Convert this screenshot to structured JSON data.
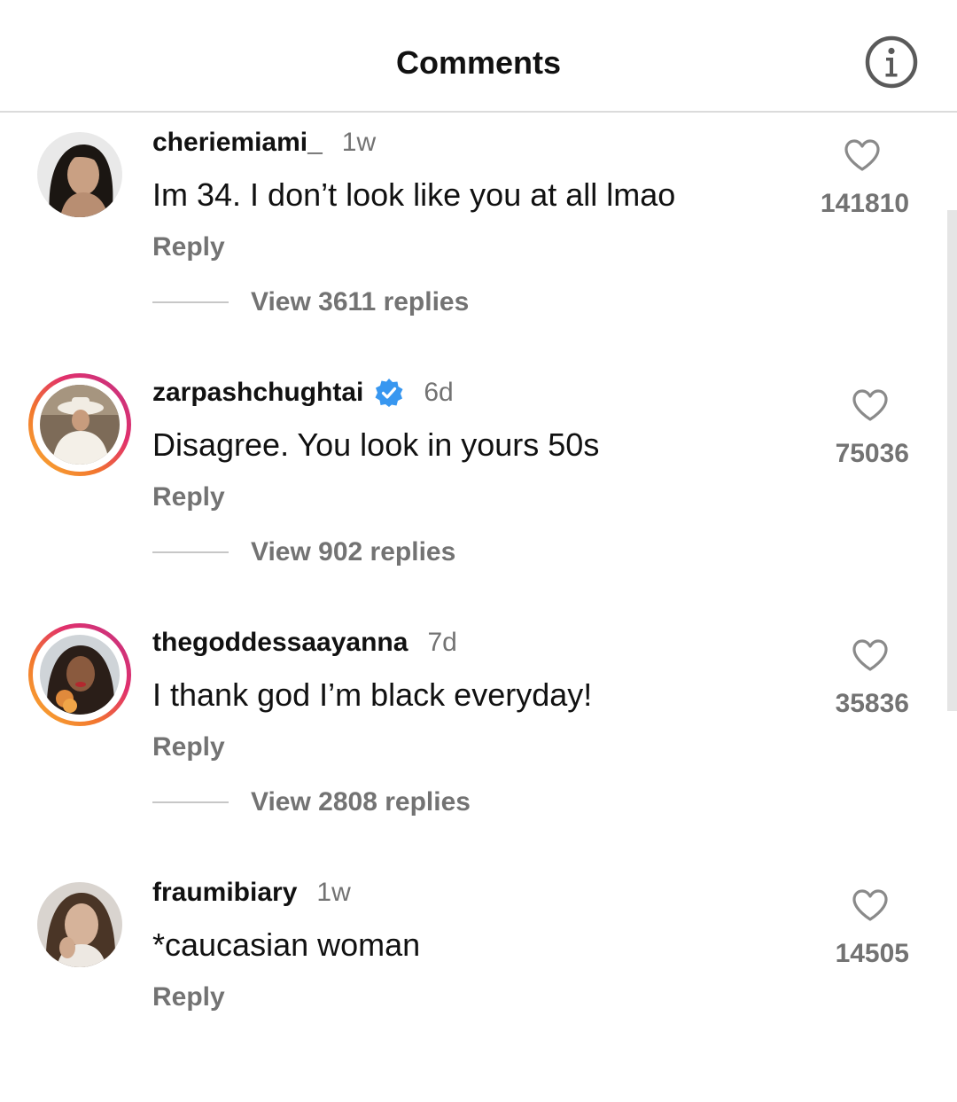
{
  "header": {
    "title": "Comments",
    "info_icon": "info-circle-icon"
  },
  "colors": {
    "text": "#111111",
    "muted": "#737373",
    "divider": "#dbdbdb",
    "verified": "#3897f0",
    "story_ring": [
      "#f9b233",
      "#f2762e",
      "#e1306c",
      "#c13584"
    ]
  },
  "comments": [
    {
      "username": "cheriemiami_",
      "verified": false,
      "time": "1w",
      "text": "Im 34. I don’t look like you at all lmao",
      "reply_label": "Reply",
      "likes": "141810",
      "view_replies": "View 3611 replies",
      "story_ring": false
    },
    {
      "username": "zarpashchughtai",
      "verified": true,
      "time": "6d",
      "text": "Disagree. You look in yours 50s",
      "reply_label": "Reply",
      "likes": "75036",
      "view_replies": "View 902 replies",
      "story_ring": true
    },
    {
      "username": "thegoddessaayanna",
      "verified": false,
      "time": "7d",
      "text": "I thank god I’m black everyday!",
      "reply_label": "Reply",
      "likes": "35836",
      "view_replies": "View 2808 replies",
      "story_ring": true
    },
    {
      "username": "fraumibiary",
      "verified": false,
      "time": "1w",
      "text": "*caucasian woman",
      "reply_label": "Reply",
      "likes": "14505",
      "story_ring": false
    }
  ]
}
